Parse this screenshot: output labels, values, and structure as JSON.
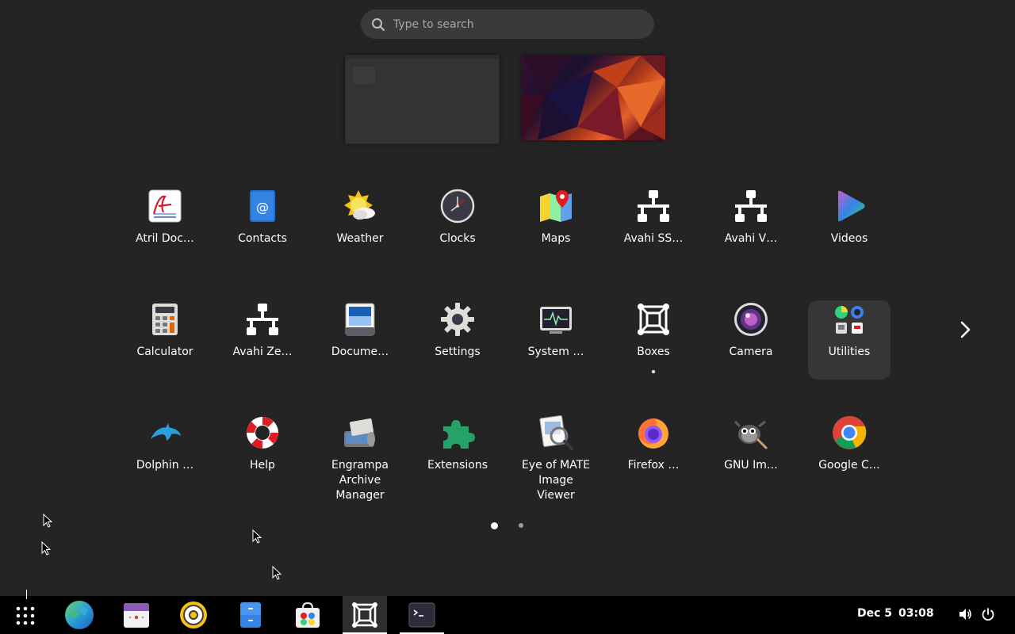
{
  "search": {
    "placeholder": "Type to search",
    "icon": "search-icon"
  },
  "workspaces": [
    {
      "name": "workspace-1"
    },
    {
      "name": "workspace-2"
    }
  ],
  "apps": [
    {
      "label": "Atril Doc…",
      "icon": "atril-document-viewer-icon"
    },
    {
      "label": "Contacts",
      "icon": "contacts-icon"
    },
    {
      "label": "Weather",
      "icon": "weather-icon"
    },
    {
      "label": "Clocks",
      "icon": "clocks-icon"
    },
    {
      "label": "Maps",
      "icon": "maps-icon"
    },
    {
      "label": "Avahi SS…",
      "icon": "network-icon"
    },
    {
      "label": "Avahi V…",
      "icon": "network-icon"
    },
    {
      "label": "Videos",
      "icon": "videos-icon"
    },
    {
      "label": "Calculator",
      "icon": "calculator-icon"
    },
    {
      "label": "Avahi Ze…",
      "icon": "network-icon"
    },
    {
      "label": "Docume…",
      "icon": "document-scanner-icon"
    },
    {
      "label": "Settings",
      "icon": "gear-icon"
    },
    {
      "label": "System …",
      "icon": "system-monitor-icon"
    },
    {
      "label": "Boxes",
      "icon": "boxes-icon",
      "running": true
    },
    {
      "label": "Camera",
      "icon": "camera-icon"
    },
    {
      "label": "Utilities",
      "icon": "folder-icon",
      "selected": true
    },
    {
      "label": "Dolphin …",
      "icon": "dolphin-icon"
    },
    {
      "label": "Help",
      "icon": "lifebuoy-icon"
    },
    {
      "label": "Engrampa Archive Manager",
      "icon": "archive-manager-icon"
    },
    {
      "label": "Extensions",
      "icon": "puzzle-icon"
    },
    {
      "label": "Eye of MATE Image Viewer",
      "icon": "image-viewer-icon"
    },
    {
      "label": "Firefox …",
      "icon": "firefox-icon"
    },
    {
      "label": "GNU Im…",
      "icon": "gimp-icon"
    },
    {
      "label": "Google C…",
      "icon": "chrome-icon"
    }
  ],
  "pager": {
    "pages": 2,
    "current": 1
  },
  "taskbar": {
    "apps": [
      {
        "name": "show-apps",
        "icon": "grid-icon"
      },
      {
        "name": "globe",
        "icon": "globe-icon"
      },
      {
        "name": "calendar",
        "icon": "calendar-icon"
      },
      {
        "name": "music",
        "icon": "music-player-icon"
      },
      {
        "name": "files",
        "icon": "files-icon"
      },
      {
        "name": "software",
        "icon": "software-store-icon"
      },
      {
        "name": "boxes",
        "icon": "boxes-icon",
        "active": true
      },
      {
        "name": "terminal",
        "icon": "terminal-icon",
        "running": true
      }
    ],
    "date": "Dec 5",
    "time": "03:08",
    "tray": [
      "volume-icon",
      "power-icon"
    ]
  },
  "colors": {
    "background": "#242424",
    "taskbar": "#000000",
    "search": "#3a3a3a",
    "accent": "#3584e4"
  }
}
